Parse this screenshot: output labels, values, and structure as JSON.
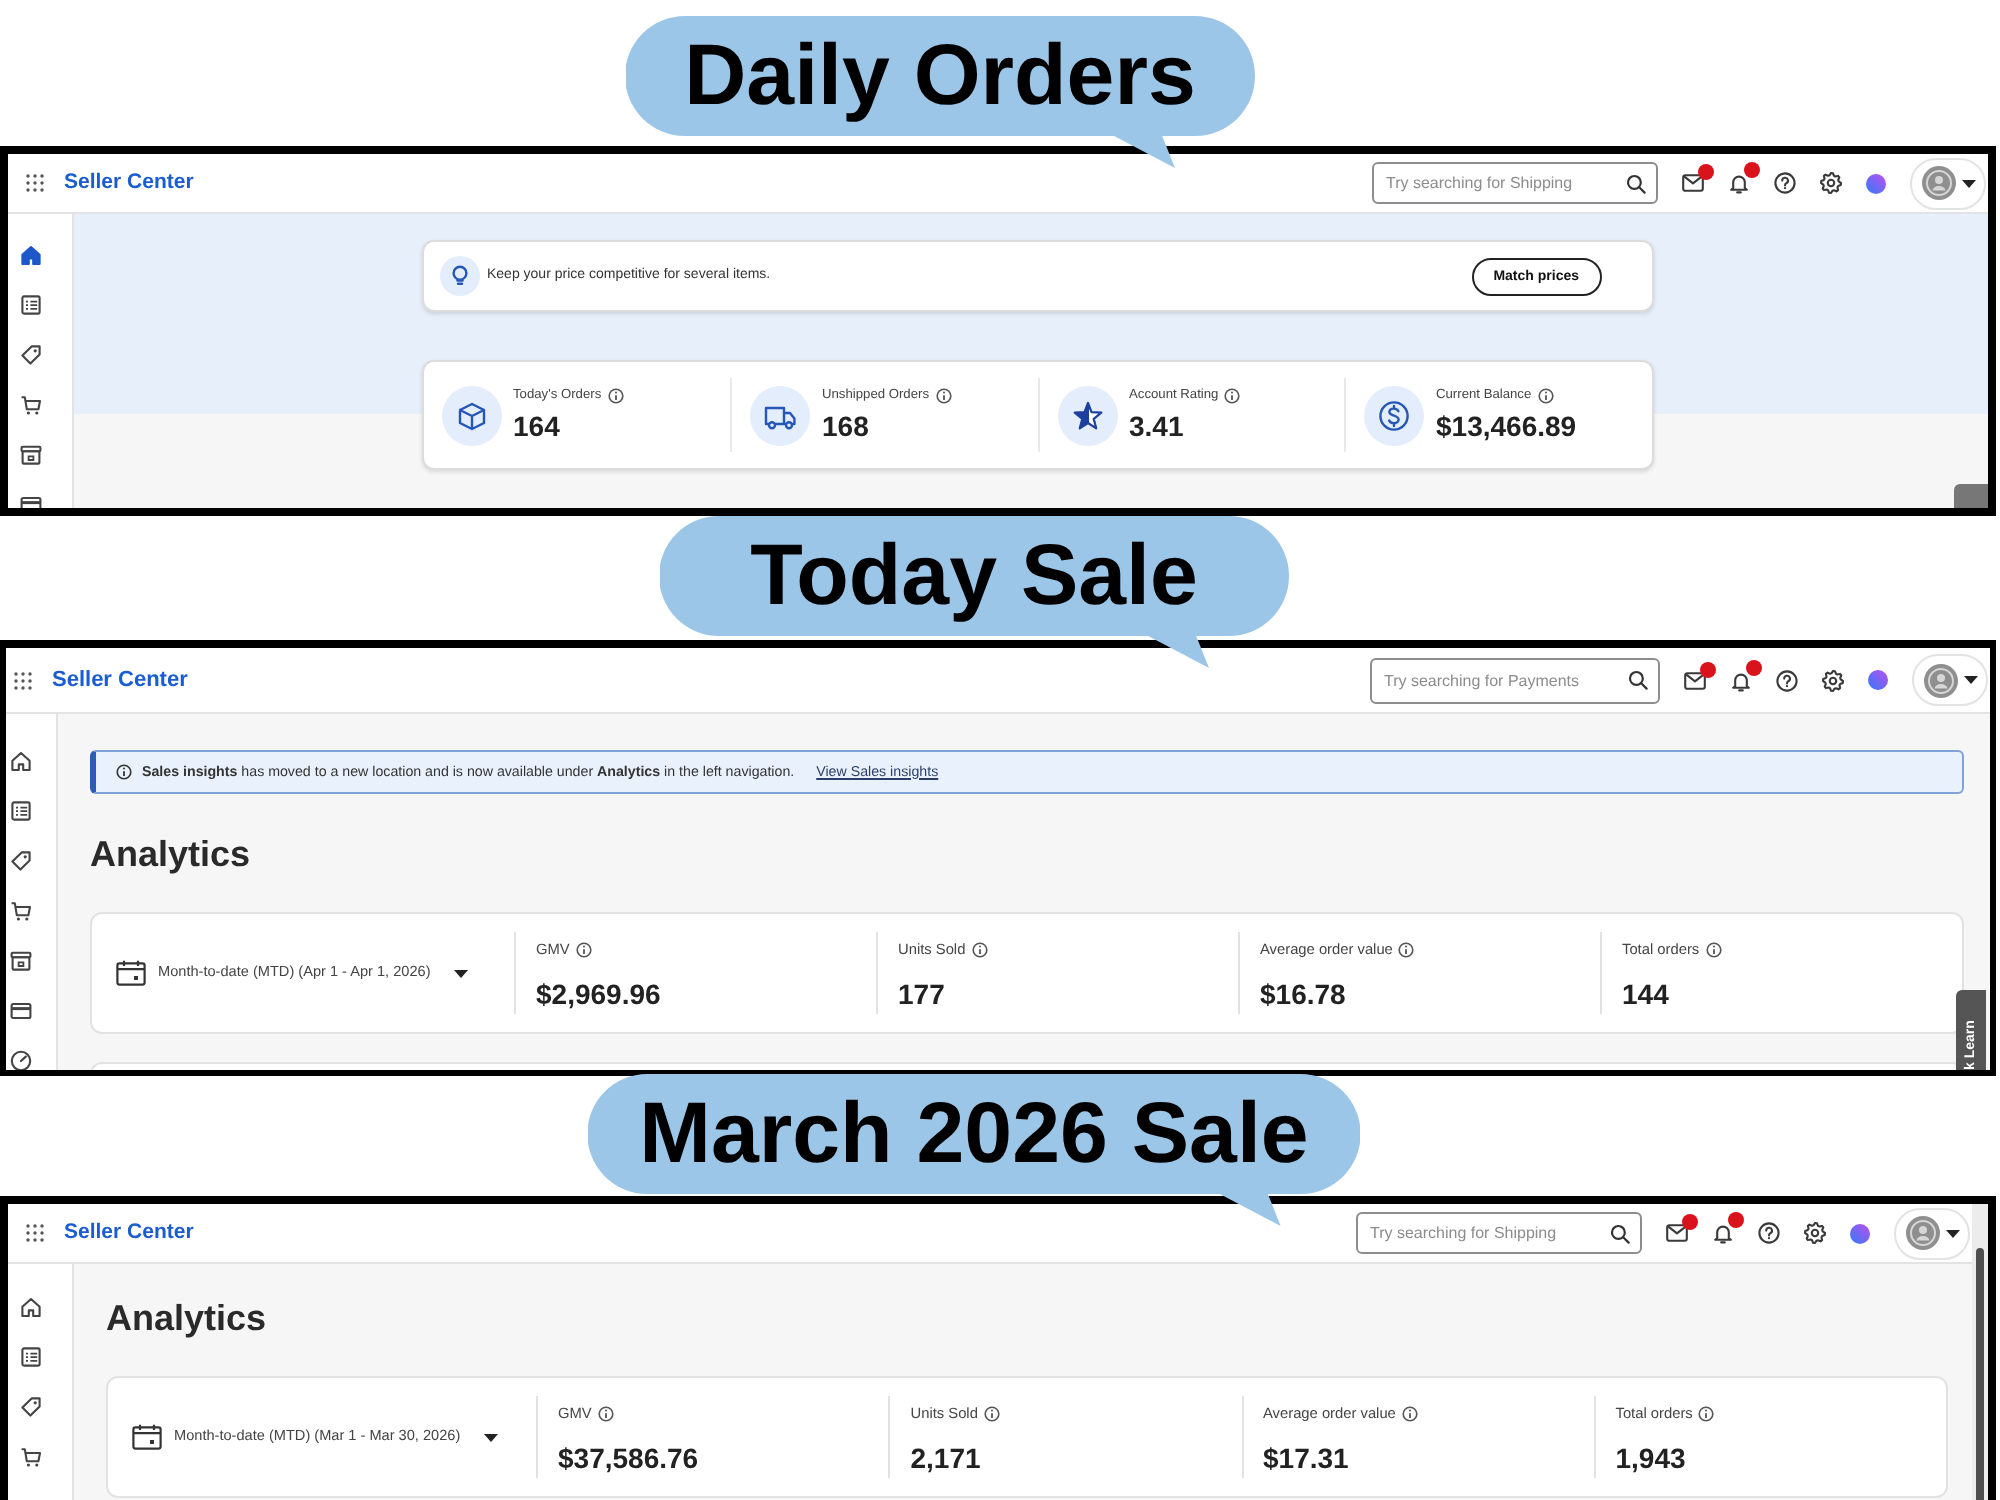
{
  "panels": [
    {
      "kind": "home",
      "label": "Daily Orders",
      "header": {
        "brand": "Seller Center",
        "search_placeholder": "Try searching for Shipping"
      },
      "sidebar": [
        {
          "selected": true
        },
        {
          "selected": false
        },
        {
          "selected": false
        },
        {
          "selected": false
        },
        {
          "selected": false
        },
        {
          "selected": false
        }
      ],
      "tip": {
        "text": "Keep your price competitive for several items.",
        "button": "Match prices"
      },
      "stats": [
        {
          "label": "Today's Orders",
          "value": "164"
        },
        {
          "label": "Unshipped Orders",
          "value": "168"
        },
        {
          "label": "Account Rating",
          "value": "3.41"
        },
        {
          "label": "Current Balance",
          "value": "$13,466.89"
        }
      ],
      "side_tab": true
    },
    {
      "kind": "analytics",
      "label": "Today Sale",
      "header": {
        "brand": "Seller Center",
        "search_placeholder": "Try searching for Payments"
      },
      "sidebar": [
        {
          "selected": false
        },
        {
          "selected": false
        },
        {
          "selected": false
        },
        {
          "selected": false
        },
        {
          "selected": false
        },
        {
          "selected": false
        },
        {
          "selected": false
        }
      ],
      "notice": {
        "text": "**Sales insights** has moved to a new location and is now available under **Analytics** in the left navigation.",
        "link": "View Sales insights"
      },
      "heading": "Analytics",
      "date_range": "Month-to-date (MTD) (Apr 1 - Apr 1, 2026)",
      "metrics": [
        {
          "label": "GMV",
          "value": "$2,969.96"
        },
        {
          "label": "Units Sold",
          "value": "177"
        },
        {
          "label": "Average order value",
          "value": "$16.78"
        },
        {
          "label": "Total orders",
          "value": "144"
        }
      ],
      "lower_card": true,
      "side_tab": "k Learn"
    },
    {
      "kind": "analytics",
      "label": "March 2026 Sale",
      "header": {
        "brand": "Seller Center",
        "search_placeholder": "Try searching for Shipping"
      },
      "sidebar": [
        {
          "selected": false
        },
        {
          "selected": false
        },
        {
          "selected": false
        },
        {
          "selected": false
        }
      ],
      "heading": "Analytics",
      "date_range": "Month-to-date (MTD) (Mar 1 - Mar 30, 2026)",
      "metrics": [
        {
          "label": "GMV",
          "value": "$37,586.76"
        },
        {
          "label": "Units Sold",
          "value": "2,171"
        },
        {
          "label": "Average order value",
          "value": "$17.31"
        },
        {
          "label": "Total orders",
          "value": "1,943"
        }
      ],
      "scrollbar": true
    }
  ]
}
